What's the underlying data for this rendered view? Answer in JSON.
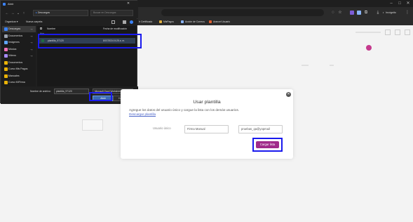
{
  "browser": {
    "profile_label": "Incógnito",
    "bookmarks": [
      {
        "label": "Ir Certificado",
        "color": "#5b9bd5"
      },
      {
        "label": "MisPagos",
        "color": "#e0b040"
      },
      {
        "label": "Acción de Correos",
        "color": "#8ab4f8"
      },
      {
        "label": "Arancel Usuario",
        "color": "#e06030"
      }
    ]
  },
  "dialog": {
    "title": "Abrir",
    "address": "Descargas",
    "search_placeholder": "Buscar en Descargas",
    "organize_label": "Organizar ▾",
    "new_folder_label": "Nueva carpeta",
    "sidebar_items": [
      {
        "label": "Descargas",
        "color": "#3b82f6"
      },
      {
        "label": "Documentos",
        "color": "#9ca3af"
      },
      {
        "label": "Imágenes",
        "color": "#60a5fa"
      },
      {
        "label": "Música",
        "color": "#f472b6"
      },
      {
        "label": "Videos",
        "color": "#a78bfa"
      },
      {
        "label": "Documentos",
        "color": "#eab308"
      },
      {
        "label": "Curso Mis Pagos",
        "color": "#eab308"
      },
      {
        "label": "Manuales",
        "color": "#eab308"
      },
      {
        "label": "Curso MIFirma",
        "color": "#eab308"
      }
    ],
    "columns": {
      "name": "Nombre",
      "modified": "Fecha de modificación"
    },
    "group_header": "Hoy",
    "file": {
      "name": "plantilla_97120",
      "modified": "8/07/2024 8:25 a. m."
    },
    "filename_label": "Nombre de archivo:",
    "filename_value": "plantilla_97120",
    "filetype_value": "Microsoft Excel Worksheet",
    "open_label": "Abrir",
    "cancel_label": "Cancelar"
  },
  "modal": {
    "title": "Usar plantilla",
    "description": "Agregue los datos del usuario único y cargue la lista con los demás usuarios.",
    "download_link": "Descargar plantilla",
    "field_label": "Usuario único",
    "field1_value": "Firma Manual",
    "field2_value": "pruebas_qa@yopmail",
    "submit_label": "Cargar lista"
  }
}
